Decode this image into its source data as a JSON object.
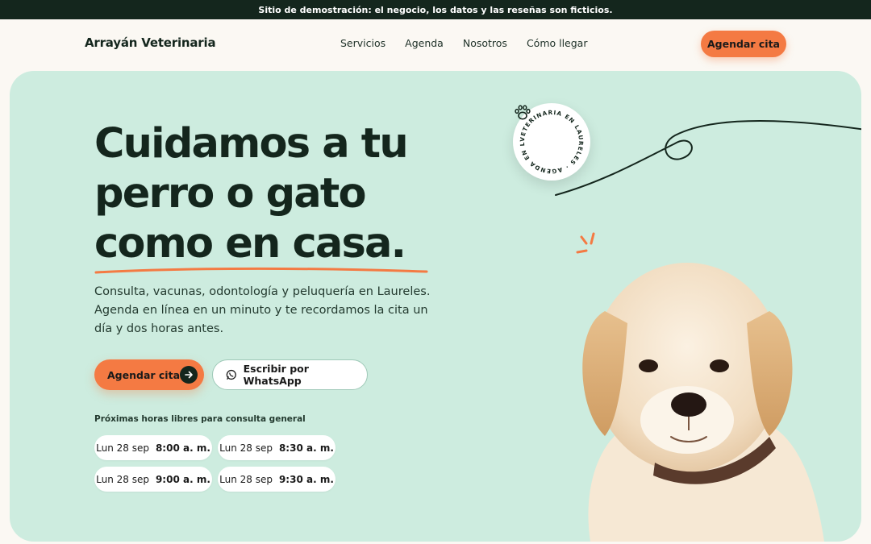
{
  "banner": {
    "text": "Sitio de demostración: el negocio, los datos y las reseñas son ficticios."
  },
  "header": {
    "brand": "Arrayán Veterinaria",
    "nav": [
      "Servicios",
      "Agenda",
      "Nosotros",
      "Cómo llegar"
    ],
    "cta": "Agendar cita"
  },
  "hero": {
    "headline": [
      "Cuidamos a tu",
      "perro o gato",
      "como en casa."
    ],
    "lead": "Consulta, vacunas, odontología y peluquería en Laureles. Agenda en línea en un minuto y te recordamos la cita un día y dos horas antes.",
    "primary_cta": "Agendar cita",
    "secondary_cta": "Escribir por WhatsApp",
    "slots_title": "Próximas horas libres para consulta general",
    "slots": [
      {
        "day": "Lun 28 sep",
        "time": "8:00 a. m."
      },
      {
        "day": "Lun 28 sep",
        "time": "8:30 a. m."
      },
      {
        "day": "Lun 28 sep",
        "time": "9:00 a. m."
      },
      {
        "day": "Lun 28 sep",
        "time": "9:30 a. m."
      }
    ],
    "badge_text": "VETERINARIA EN LAURELES · AGENDA EN LÍNEA ·"
  },
  "icons": {
    "arrow": "arrow-right-icon",
    "whatsapp": "whatsapp-icon",
    "paw": "paw-icon"
  },
  "colors": {
    "accent": "#f47a43",
    "dark": "#14261d",
    "hero_bg": "#cdecdf",
    "page_bg": "#fbf8f3"
  }
}
